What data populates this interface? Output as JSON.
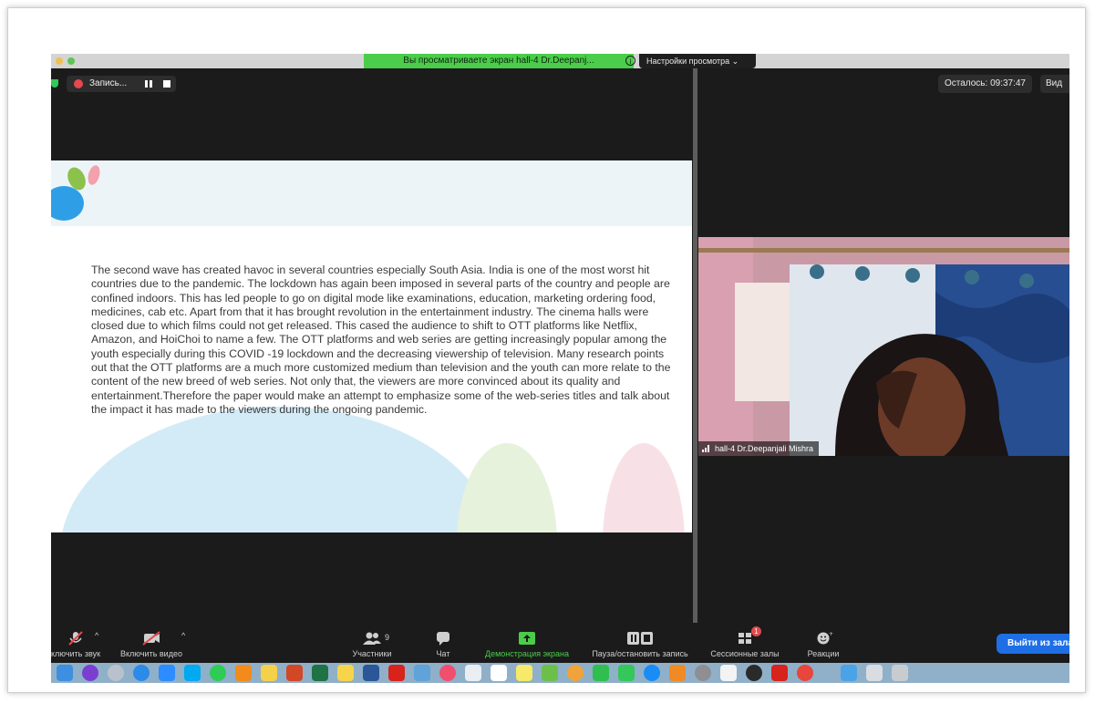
{
  "banner": {
    "text": "Вы просматриваете экран hall-4 Dr.Deepanj...",
    "info_icon": "info-icon"
  },
  "view_settings": {
    "label": "Настройки просмотра ⌄"
  },
  "recording": {
    "label": "Запись...",
    "pause_icon": "pause-icon",
    "stop_icon": "stop-icon"
  },
  "remaining": {
    "label": "Осталось: 09:37:47"
  },
  "view_button": {
    "label": "Вид"
  },
  "slide": {
    "text": "The second wave has created havoc in several countries especially South Asia. India is one of the most worst hit countries due to the pandemic. The lockdown has again been imposed in several parts of the country and people are confined indoors. This has led people to go on digital mode like examinations, education, marketing ordering food, medicines, cab etc. Apart from that it has brought revolution in the entertainment industry. The cinema halls were closed due to which films could not get released. This cased the audience to  shift to OTT platforms like Netflix, Amazon, and HoiChoi to name a few. The OTT platforms and web series are getting increasingly popular among the youth especially during this COVID -19 lockdown and the decreasing viewership of television. Many research points out that the OTT platforms are a much more customized medium than television and the youth can more relate to the content of the new breed of web series. Not only that, the viewers are more convinced about its quality and entertainment.Therefore the paper would make an attempt to emphasize some of  the web-series titles and talk about the impact it has made to the viewers during the ongoing pandemic."
  },
  "video": {
    "participant_name": "hall-4 Dr.Deepanjali Mishra"
  },
  "toolbar": {
    "mute_label": "ключить звук",
    "video_label": "Включить видео",
    "participants_label": "Участники",
    "participants_count": "9",
    "chat_label": "Чат",
    "share_label": "Демонстрация экрана",
    "pause_record_label": "Пауза/остановить запись",
    "breakout_label": "Сессионные залы",
    "breakout_badge": "1",
    "reactions_label": "Реакции",
    "leave_label": "Выйти из зала"
  },
  "colors": {
    "accent_green": "#4bcc4b",
    "leave_blue": "#1e6fe6",
    "record_red": "#e5484d"
  }
}
